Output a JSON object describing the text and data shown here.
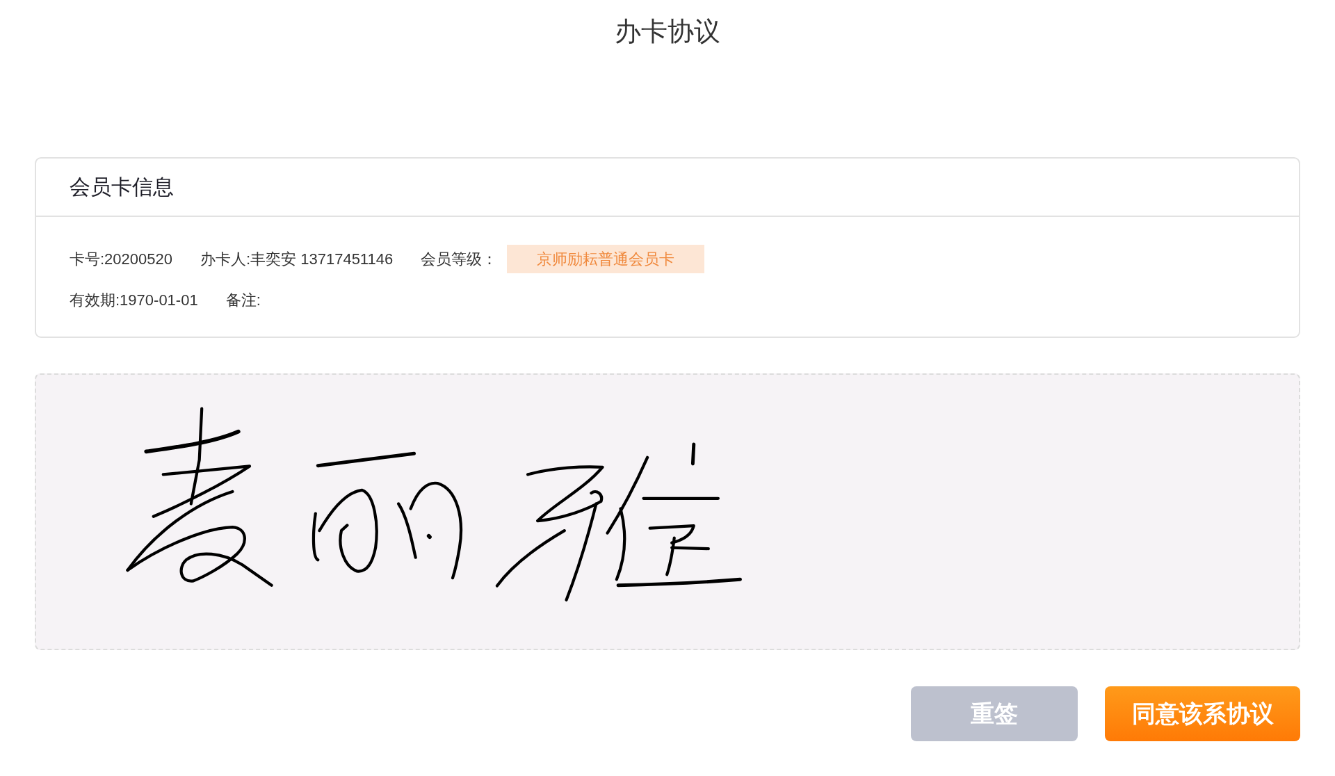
{
  "page": {
    "title": "办卡协议"
  },
  "member_card": {
    "title": "会员卡信息",
    "rows": [
      [
        {
          "kind": "text",
          "text": "卡号:20200520"
        },
        {
          "kind": "text",
          "text": "办卡人:丰奕安 13717451146"
        },
        {
          "kind": "tag",
          "label": "会员等级：",
          "value": "京师励耘普通会员卡"
        }
      ],
      [
        {
          "kind": "text",
          "text": "有效期:1970-01-01"
        },
        {
          "kind": "text",
          "text": "备注:"
        }
      ]
    ]
  },
  "signature_pad": {
    "signed": true
  },
  "buttons": [
    {
      "label": "重签",
      "kind": "secondary"
    },
    {
      "label": "同意该系协议",
      "kind": "primary"
    }
  ]
}
